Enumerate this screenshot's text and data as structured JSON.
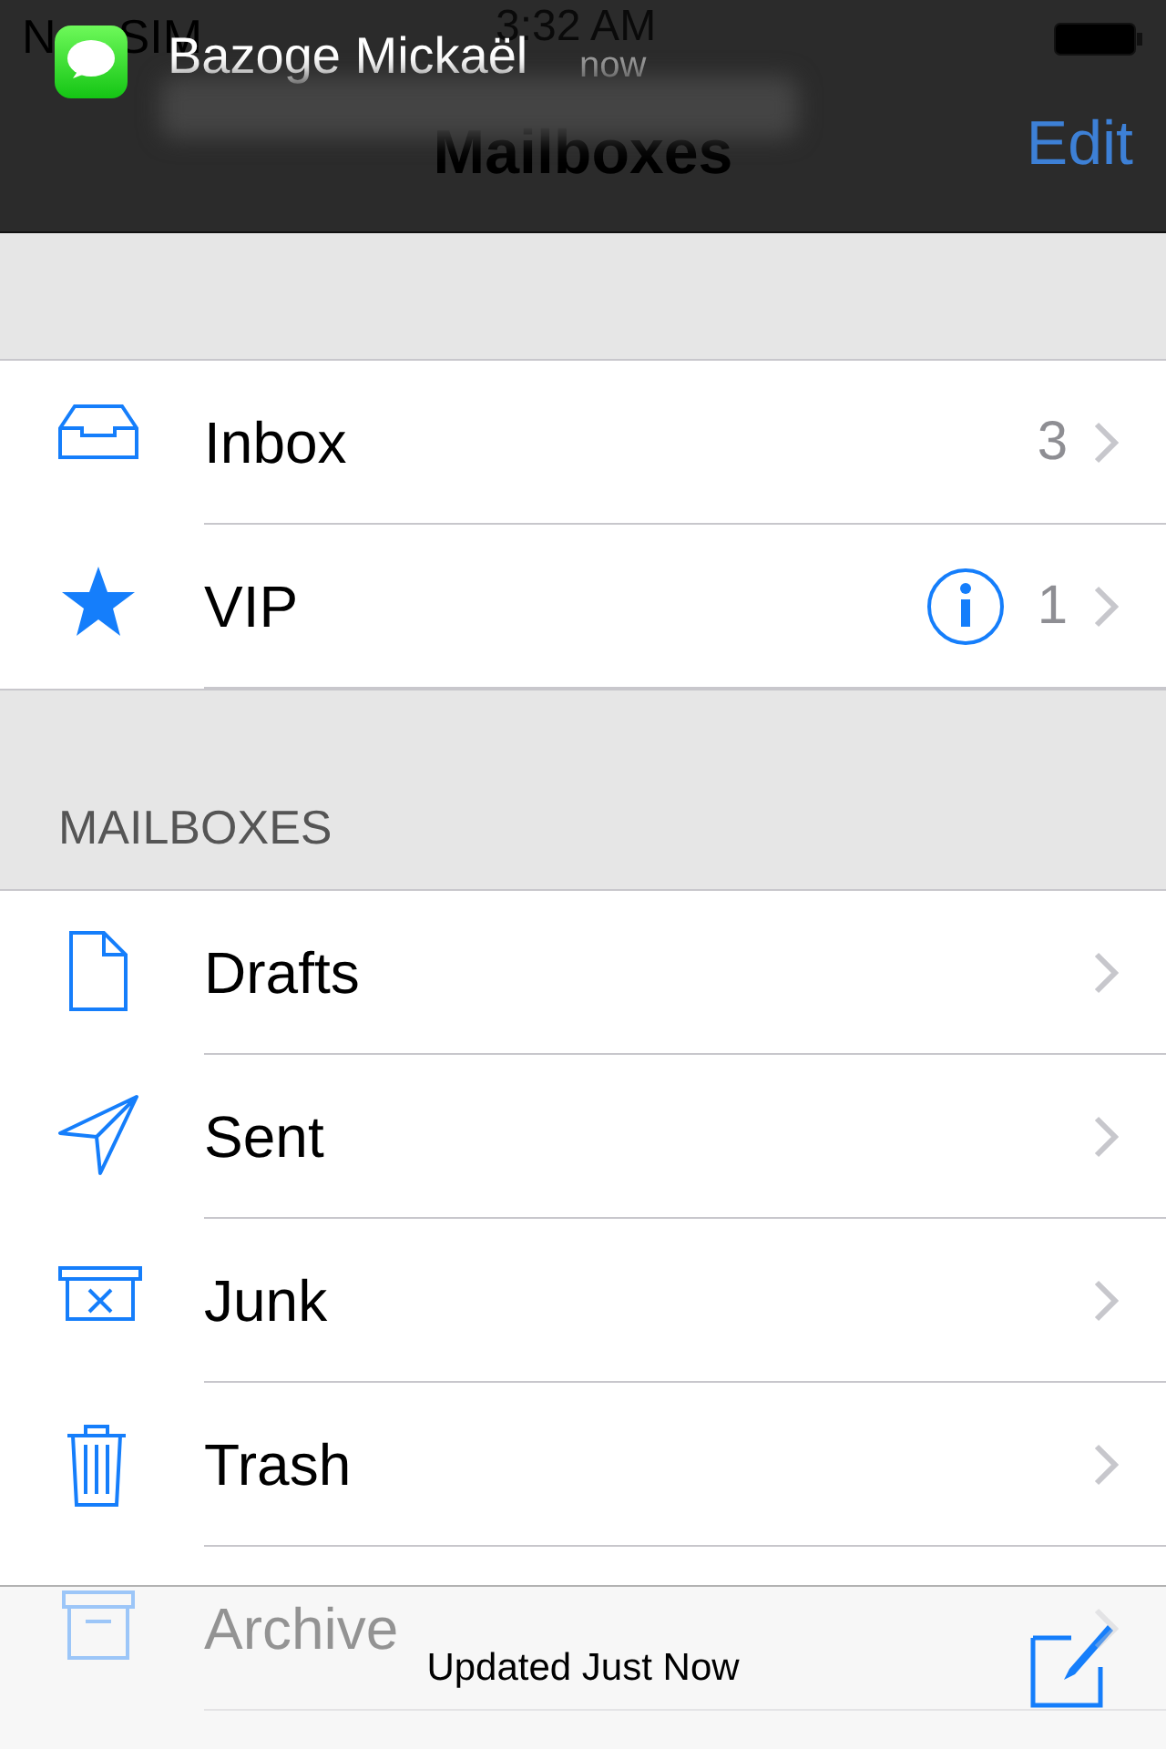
{
  "status_bar": {
    "carrier_parts": [
      "N",
      "SIM"
    ],
    "time": "3:32 AM"
  },
  "notification": {
    "sender": "Bazoge Mickaël",
    "time": "now"
  },
  "nav_bar": {
    "title": "Mailboxes",
    "edit_button": "Edit"
  },
  "favorites": [
    {
      "kind": "inbox",
      "label": "Inbox",
      "count": "3",
      "info": false
    },
    {
      "kind": "vip",
      "label": "VIP",
      "count": "1",
      "info": true
    }
  ],
  "mailboxes_header": "MAILBOXES",
  "mailboxes": [
    {
      "kind": "drafts",
      "label": "Drafts"
    },
    {
      "kind": "sent",
      "label": "Sent"
    },
    {
      "kind": "junk",
      "label": "Junk"
    },
    {
      "kind": "trash",
      "label": "Trash"
    },
    {
      "kind": "archive",
      "label": "Archive"
    }
  ],
  "toolbar": {
    "status": "Updated Just Now"
  }
}
